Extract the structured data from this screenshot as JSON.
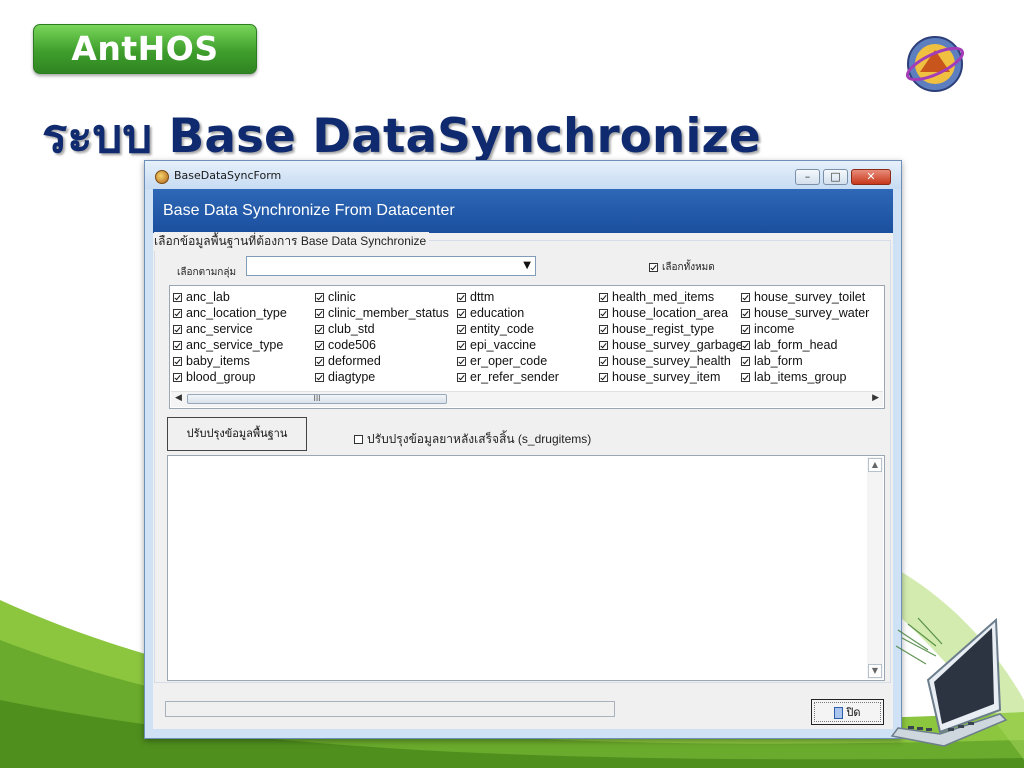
{
  "slide": {
    "logo_text": "AntHOS",
    "title": "ระบบ Base DataSynchronize"
  },
  "window": {
    "title": "BaseDataSyncForm",
    "header": "Base Data Synchronize From Datacenter",
    "controls": {
      "minimize": "–",
      "maximize": "□",
      "close": "✕"
    }
  },
  "group": {
    "legend": "เลือกข้อมูลพื้นฐานที่ต้องการ Base Data Synchronize",
    "filter_label": "เลือกตามกลุ่ม",
    "filter_value": "",
    "select_all_label": "เลือกทั้งหมด",
    "select_all_checked": true
  },
  "tables": {
    "columns": [
      [
        "anc_lab",
        "anc_location_type",
        "anc_service",
        "anc_service_type",
        "baby_items",
        "blood_group"
      ],
      [
        "clinic",
        "clinic_member_status",
        "club_std",
        "code506",
        "deformed",
        "diagtype"
      ],
      [
        "dttm",
        "education",
        "entity_code",
        "epi_vaccine",
        "er_oper_code",
        "er_refer_sender"
      ],
      [
        "health_med_items",
        "house_location_area",
        "house_regist_type",
        "house_survey_garbage",
        "house_survey_health",
        "house_survey_item"
      ],
      [
        "house_survey_toilet",
        "house_survey_water",
        "income",
        "lab_form_head",
        "lab_form",
        "lab_items_group"
      ]
    ],
    "all_checked": true,
    "scroll_thumb_glyph": "III"
  },
  "actions": {
    "update_button": "ปรับปรุงข้อมูลพื้นฐาน",
    "drug_update_label": "ปรับปรุงข้อมูลยาหลังเสร็จสิ้น (s_drugitems)",
    "drug_update_checked": false,
    "close_button": "ปิด"
  },
  "log": {
    "text": ""
  },
  "status": {
    "text": ""
  },
  "colors": {
    "title": "#0f2a6e",
    "header_band": "#1a4f9e",
    "logo_green": "#3f9e2c",
    "wave_green": "#8cc63f"
  }
}
